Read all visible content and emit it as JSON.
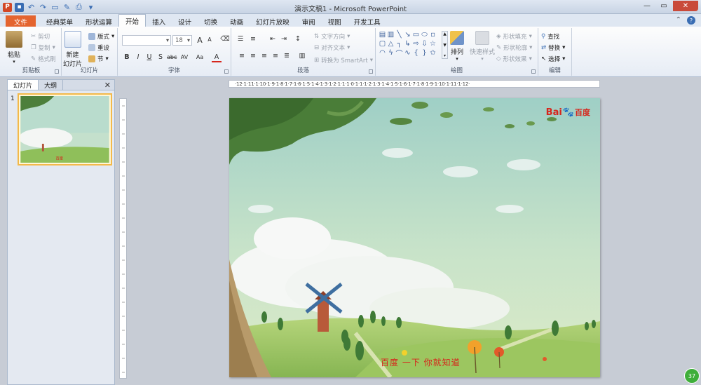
{
  "window": {
    "title": "演示文稿1 - Microsoft PowerPoint",
    "app_icon": "P"
  },
  "tabs": [
    "文件",
    "经典菜单",
    "形状运算",
    "开始",
    "插入",
    "设计",
    "切换",
    "动画",
    "幻灯片放映",
    "审阅",
    "视图",
    "开发工具"
  ],
  "active_tab": "开始",
  "ribbon": {
    "clipboard": {
      "label": "剪贴板",
      "paste": "粘贴",
      "cut": "剪切",
      "copy": "复制",
      "format_painter": "格式刷"
    },
    "slides": {
      "label": "幻灯片",
      "new_slide_1": "新建",
      "new_slide_2": "幻灯片",
      "layout": "版式",
      "reset": "重设",
      "section": "节"
    },
    "font": {
      "label": "字体",
      "font_name": "",
      "font_size": "18",
      "bold": "B",
      "italic": "I",
      "underline": "U",
      "shadow": "S",
      "strike": "abc",
      "spacing": "AV",
      "case": "Aa",
      "color": "A",
      "grow": "A",
      "shrink": "A"
    },
    "paragraph": {
      "label": "段落",
      "text_direction": "文字方向",
      "align_text": "对齐文本",
      "smartart": "转换为 SmartArt"
    },
    "drawing": {
      "label": "绘图",
      "arrange": "排列",
      "quick_styles": "快速样式",
      "shape_fill": "形状填充",
      "shape_outline": "形状轮廓",
      "shape_effects": "形状效果"
    },
    "editing": {
      "label": "编辑",
      "find": "查找",
      "replace": "替换",
      "select": "选择"
    }
  },
  "pane": {
    "tabs": [
      "幻灯片",
      "大纲"
    ],
    "close": "✕",
    "slide_number": "1"
  },
  "slide": {
    "logo_text": "Bai",
    "logo_cn": "百度",
    "caption": "百度 一下  你就知道"
  },
  "ruler_h_labels": "·12·1·11·1·10·1·9·1·8·1·7·1·6·1·5·1·4·1·3·1·2·1·1·1·0·1·1·1·2·1·3·1·4·1·5·1·6·1·7·1·8·1·9·1·10·1·11·1·12·",
  "badge": "37",
  "colors": {
    "file_tab": "#e4642f",
    "ribbon": "#fdfdfd",
    "accent_red": "#d6261c",
    "brand_blue": "#2a55b8"
  }
}
